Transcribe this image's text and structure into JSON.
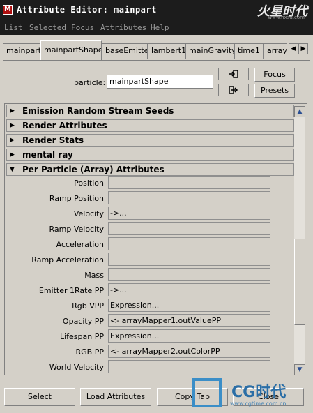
{
  "window": {
    "title": "Attribute Editor: mainpart",
    "logo_top": "火星时代",
    "logo_top_sub": "www.hxsd.com"
  },
  "menu": [
    "List",
    "Selected",
    "Focus",
    "Attributes",
    "Help"
  ],
  "tabs": [
    "mainpart",
    "mainpartShape",
    "baseEmitter",
    "lambert1",
    "mainGravity",
    "time1",
    "array"
  ],
  "active_tab": "mainpartShape",
  "particle": {
    "label": "particle:",
    "value": "mainpartShape"
  },
  "buttons": {
    "focus": "Focus",
    "presets": "Presets",
    "select": "Select",
    "load_attributes": "Load Attributes",
    "copy_tab": "Copy Tab",
    "close": "Close"
  },
  "sections": [
    {
      "title": "Emission Random Stream Seeds",
      "expanded": false
    },
    {
      "title": "Render Attributes",
      "expanded": false
    },
    {
      "title": "Render Stats",
      "expanded": false
    },
    {
      "title": "mental ray",
      "expanded": false
    },
    {
      "title": "Per Particle (Array) Attributes",
      "expanded": true
    }
  ],
  "attributes": [
    {
      "label": "Position",
      "value": ""
    },
    {
      "label": "Ramp Position",
      "value": ""
    },
    {
      "label": "Velocity",
      "value": "->..."
    },
    {
      "label": "Ramp Velocity",
      "value": ""
    },
    {
      "label": "Acceleration",
      "value": ""
    },
    {
      "label": "Ramp Acceleration",
      "value": ""
    },
    {
      "label": "Mass",
      "value": ""
    },
    {
      "label": "Emitter 1Rate PP",
      "value": "->..."
    },
    {
      "label": "Rgb VPP",
      "value": "Expression..."
    },
    {
      "label": "Opacity PP",
      "value": "<- arrayMapper1.outValuePP"
    },
    {
      "label": "Lifespan PP",
      "value": "Expression..."
    },
    {
      "label": "RGB PP",
      "value": "<- arrayMapper2.outColorPP"
    },
    {
      "label": "World Velocity",
      "value": ""
    }
  ],
  "watermark": {
    "name": "CG时代",
    "url": "www.cgtime.com.cn"
  },
  "colors": {
    "titlebar": "#1c1c1c",
    "panel": "#d4d0c8",
    "accent": "#3b8ec7"
  }
}
